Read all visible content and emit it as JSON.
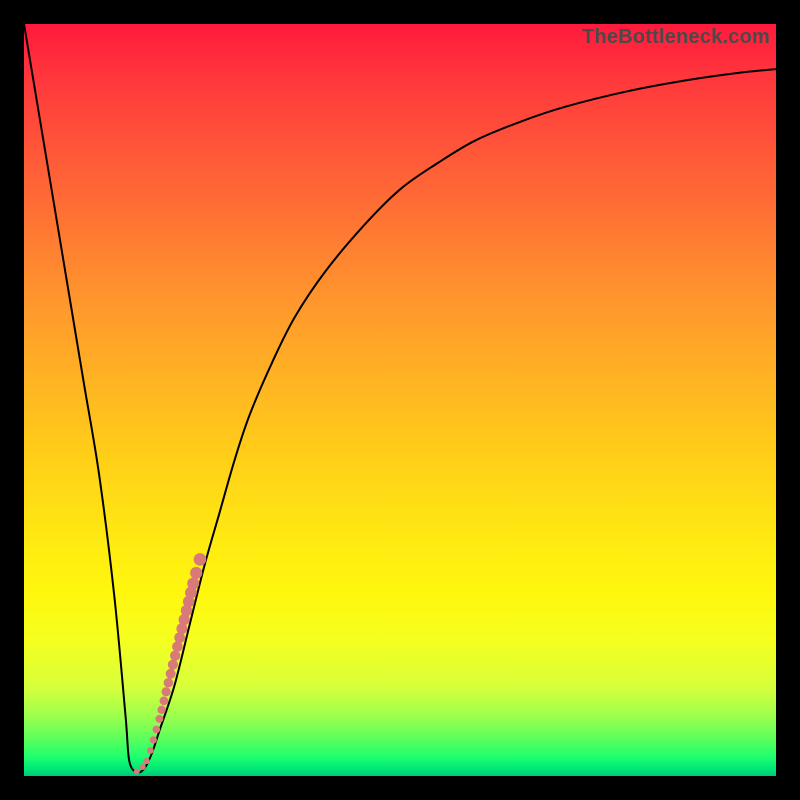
{
  "watermark": "TheBottleneck.com",
  "colors": {
    "curve": "#000000",
    "dots": "#d87a78",
    "frame": "#000000"
  },
  "chart_data": {
    "type": "line",
    "title": "",
    "xlabel": "",
    "ylabel": "",
    "xlim": [
      0,
      100
    ],
    "ylim": [
      0,
      100
    ],
    "series": [
      {
        "name": "bottleneck-curve",
        "x": [
          0,
          2,
          4,
          6,
          8,
          10,
          12,
          13.5,
          14,
          15,
          16,
          17,
          18,
          20,
          22,
          24,
          26,
          28,
          30,
          33,
          36,
          40,
          45,
          50,
          55,
          60,
          66,
          72,
          80,
          88,
          95,
          100
        ],
        "y": [
          100,
          88,
          76,
          64,
          52,
          40,
          24,
          8,
          2,
          0.5,
          1,
          3,
          6,
          12,
          20,
          28,
          35,
          42,
          48,
          55,
          61,
          67,
          73,
          78,
          81.5,
          84.5,
          87,
          89,
          91,
          92.5,
          93.5,
          94
        ]
      }
    ],
    "markers": {
      "name": "highlight-dots",
      "x": [
        15.0,
        15.8,
        16.3,
        16.8,
        17.2,
        17.6,
        18.0,
        18.3,
        18.6,
        18.9,
        19.2,
        19.5,
        19.8,
        20.1,
        20.4,
        20.7,
        21.0,
        21.3,
        21.6,
        21.9,
        22.2,
        22.5,
        22.9,
        23.4
      ],
      "y": [
        0.6,
        1.2,
        2.0,
        3.4,
        4.8,
        6.2,
        7.6,
        8.8,
        10.0,
        11.2,
        12.4,
        13.6,
        14.8,
        16.0,
        17.2,
        18.4,
        19.6,
        20.8,
        22.0,
        23.2,
        24.4,
        25.6,
        27.0,
        28.8
      ],
      "r": [
        3.0,
        3.0,
        3.2,
        3.4,
        3.6,
        3.8,
        4.0,
        4.2,
        4.4,
        4.6,
        4.8,
        5.0,
        5.1,
        5.2,
        5.3,
        5.4,
        5.5,
        5.6,
        5.7,
        5.8,
        5.9,
        6.0,
        6.1,
        6.3
      ]
    }
  }
}
